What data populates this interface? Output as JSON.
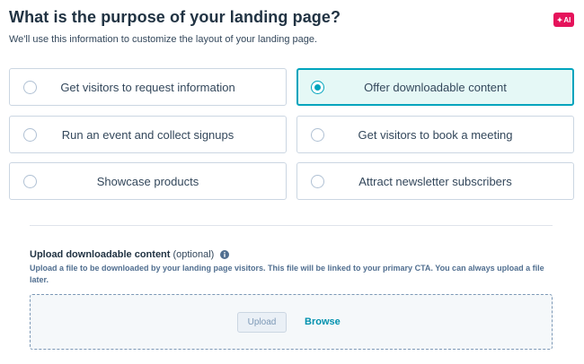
{
  "header": {
    "title": "What is the purpose of your landing page?",
    "subtitle": "We'll use this information to customize the layout of your landing page.",
    "ai_badge": "AI",
    "ai_badge_icon": "sparkle-icon",
    "ai_badge_color": "#e5135b"
  },
  "options": [
    {
      "label": "Get visitors to request information",
      "selected": false
    },
    {
      "label": "Offer downloadable content",
      "selected": true
    },
    {
      "label": "Run an event and collect signups",
      "selected": false
    },
    {
      "label": "Get visitors to book a meeting",
      "selected": false
    },
    {
      "label": "Showcase products",
      "selected": false
    },
    {
      "label": "Attract newsletter subscribers",
      "selected": false
    }
  ],
  "upload": {
    "title": "Upload downloadable content",
    "optional": "(optional)",
    "info_icon": "info-icon",
    "description": "Upload a file to be downloaded by your landing page visitors. This file will be linked to your primary CTA. You can always upload a file later.",
    "upload_label": "Upload",
    "browse_label": "Browse"
  },
  "colors": {
    "accent": "#00a4bd",
    "selected_bg": "#e5f8f6",
    "link": "#0091ae"
  }
}
